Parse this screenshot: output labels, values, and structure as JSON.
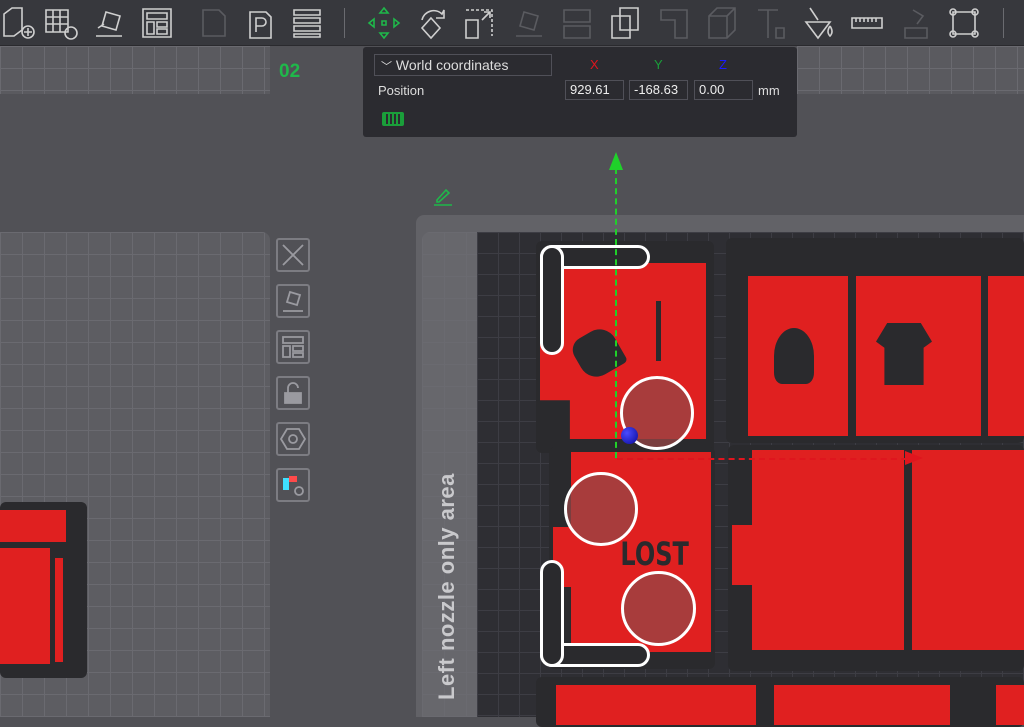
{
  "toolbar": {
    "tools": [
      "add-plate",
      "add-grid-plate",
      "auto-orient",
      "arrange",
      "plate-o",
      "plate-p",
      "layers",
      "move",
      "rotate",
      "scale",
      "lay-on-face",
      "split",
      "boolean",
      "cut",
      "assembly",
      "text",
      "paint",
      "measure",
      "support-paint",
      "seam"
    ]
  },
  "plate_label": "02",
  "coord_panel": {
    "mode": "World coordinates",
    "row_label": "Position",
    "axes": {
      "x": "X",
      "y": "Y",
      "z": "Z"
    },
    "x": "929.61",
    "y": "-168.63",
    "z": "0.00",
    "unit": "mm"
  },
  "side_tools": [
    "delete-plate",
    "auto-orient-plate",
    "arrange-plate",
    "lock-plate",
    "plate-settings",
    "filament-settings"
  ],
  "plate": {
    "region_label": "Left nozzle only area",
    "part_text": "LOST"
  },
  "colors": {
    "accent": "#1fb84a",
    "x_axis": "#e0151e",
    "y_axis": "#1a9e3a",
    "z_axis": "#1a1aff",
    "part": "#e02020"
  }
}
